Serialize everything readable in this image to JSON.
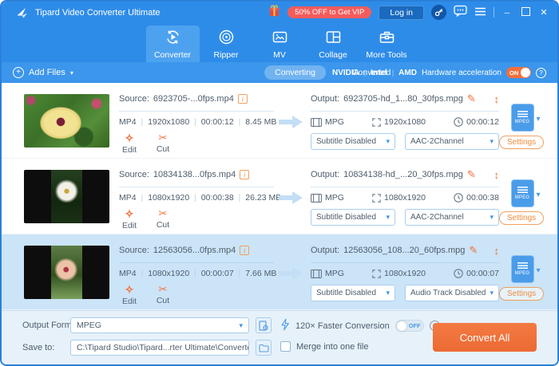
{
  "titlebar": {
    "title": "Tipard Video Converter Ultimate",
    "vip_badge": "50% OFF to Get VIP",
    "login": "Log in"
  },
  "tabs": [
    {
      "label": "Converter",
      "active": true
    },
    {
      "label": "Ripper",
      "active": false
    },
    {
      "label": "MV",
      "active": false
    },
    {
      "label": "Collage",
      "active": false
    },
    {
      "label": "More Tools",
      "active": false
    }
  ],
  "toolbar": {
    "add_files": "Add Files",
    "converting": "Converting",
    "converted": "Converted",
    "gpu_brands": [
      "NVIDIA",
      "Intel",
      "AMD"
    ],
    "hw_label": "Hardware acceleration",
    "hw_state": "ON"
  },
  "labels": {
    "source_prefix": "Source:",
    "output_prefix": "Output:",
    "edit": "Edit",
    "cut": "Cut",
    "settings": "Settings"
  },
  "files": [
    {
      "source_name": "6923705-...0fps.mp4",
      "format": "MP4",
      "resolution": "1920x1080",
      "duration": "00:00:12",
      "size": "8.45 MB",
      "output_name": "6923705-hd_1...80_30fps.mpg",
      "out_format": "MPG",
      "out_resolution": "1920x1080",
      "out_duration": "00:00:12",
      "subtitle": "Subtitle Disabled",
      "audio": "AAC-2Channel",
      "profile": "MPEG",
      "selected": false,
      "thumb": "thumb-hibiscus"
    },
    {
      "source_name": "10834138...0fps.mp4",
      "format": "MP4",
      "resolution": "1080x1920",
      "duration": "00:00:38",
      "size": "26.23 MB",
      "output_name": "10834138-hd_...20_30fps.mpg",
      "out_format": "MPG",
      "out_resolution": "1080x1920",
      "out_duration": "00:00:38",
      "subtitle": "Subtitle Disabled",
      "audio": "AAC-2Channel",
      "profile": "MPEG",
      "selected": false,
      "thumb": "thumb-white-flower"
    },
    {
      "source_name": "12563056...0fps.mp4",
      "format": "MP4",
      "resolution": "1080x1920",
      "duration": "00:00:07",
      "size": "7.66 MB",
      "output_name": "12563056_108...20_60fps.mpg",
      "out_format": "MPG",
      "out_resolution": "1080x1920",
      "out_duration": "00:00:07",
      "subtitle": "Subtitle Disabled",
      "audio": "Audio Track Disabled",
      "profile": "MPEG",
      "selected": true,
      "thumb": "thumb-pink-flower"
    }
  ],
  "footer": {
    "output_format_label": "Output Format:",
    "output_format_value": "MPEG",
    "save_to_label": "Save to:",
    "save_to_value": "C:\\Tipard Studio\\Tipard...rter Ultimate\\Converted",
    "faster_label": "120× Faster Conversion",
    "faster_state": "OFF",
    "merge_label": "Merge into one file",
    "convert_all": "Convert All"
  },
  "colors": {
    "header_blue": "#2E8CE9",
    "accent_orange": "#F0703C",
    "badge_red": "#F45C5C",
    "selected_row": "#CBE4F8",
    "toggle_on": "#F2703C"
  }
}
